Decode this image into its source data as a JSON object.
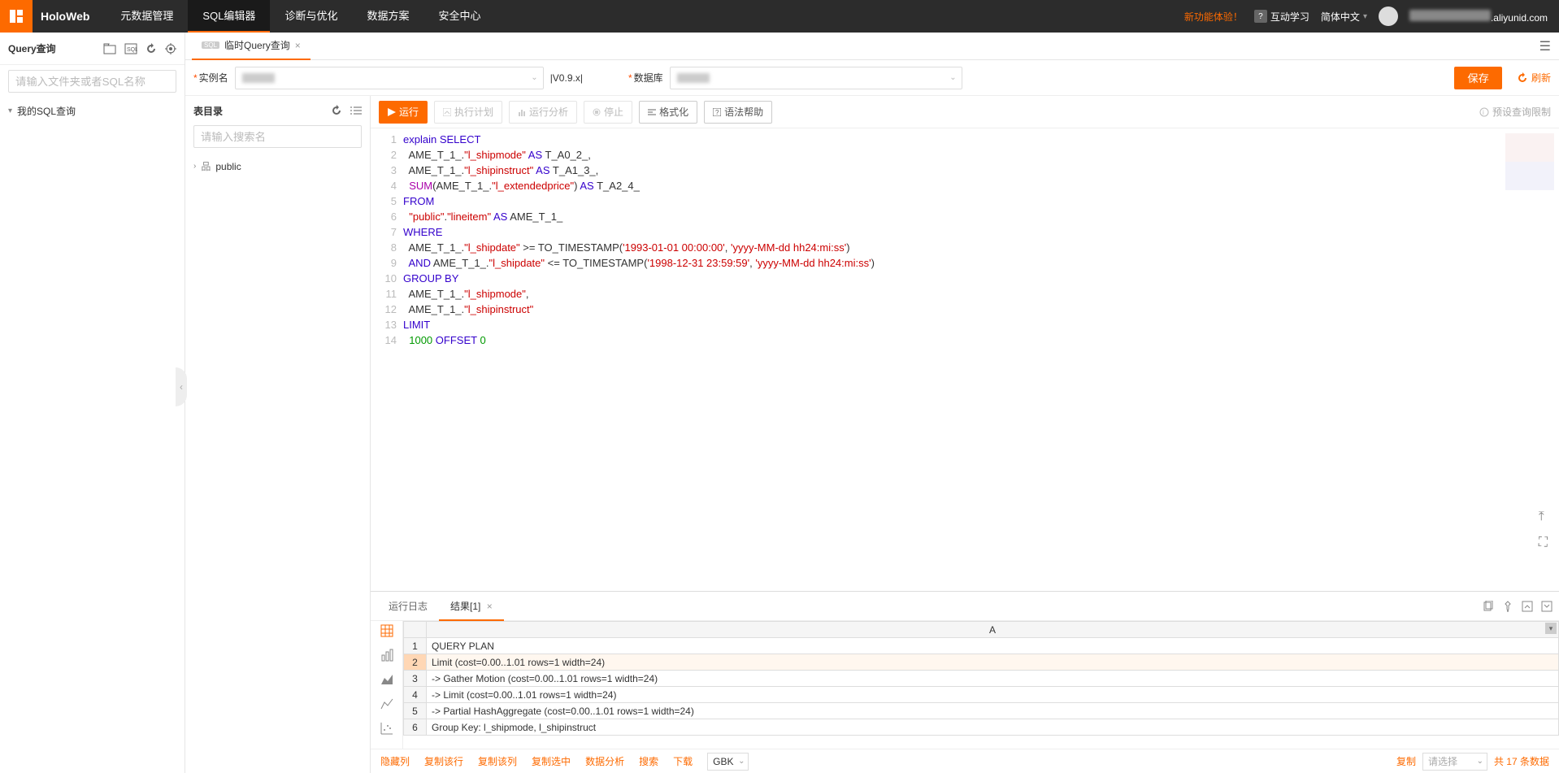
{
  "brand": "HoloWeb",
  "nav": [
    "元数据管理",
    "SQL编辑器",
    "诊断与优化",
    "数据方案",
    "安全中心"
  ],
  "nav_active": 1,
  "top_right": {
    "new_exp": "新功能体验！",
    "interactive": "互动学习",
    "lang": "简体中文",
    "user_suffix": ".aliyunid.com"
  },
  "sidebar": {
    "title": "Query查询",
    "search_ph": "请输入文件夹或者SQL名称",
    "tree_root": "我的SQL查询"
  },
  "tab": {
    "label": "临时Query查询"
  },
  "params": {
    "instance_lbl": "实例名",
    "version": "|V0.9.x|",
    "db_lbl": "数据库",
    "save": "保存",
    "refresh": "刷新"
  },
  "table_panel": {
    "title": "表目录",
    "search_ph": "请输入搜索名",
    "node": "public"
  },
  "toolbar": {
    "run": "运行",
    "plan": "执行计划",
    "analyze": "运行分析",
    "stop": "停止",
    "format": "格式化",
    "grammar": "语法帮助",
    "hint": "预设查询限制"
  },
  "code_lines": [
    [
      [
        "kw",
        "explain"
      ],
      [
        "",
        ""
      ],
      [
        "",
        " "
      ],
      [
        "kw",
        "SELECT"
      ]
    ],
    [
      [
        "",
        "  AME_T_1_."
      ],
      [
        "col",
        "\"l_shipmode\""
      ],
      [
        "",
        " "
      ],
      [
        "kw",
        "AS"
      ],
      [
        "",
        " T_A0_2_,"
      ]
    ],
    [
      [
        "",
        "  AME_T_1_."
      ],
      [
        "col",
        "\"l_shipinstruct\""
      ],
      [
        "",
        " "
      ],
      [
        "kw",
        "AS"
      ],
      [
        "",
        " T_A1_3_,"
      ]
    ],
    [
      [
        "",
        "  "
      ],
      [
        "fn",
        "SUM"
      ],
      [
        "",
        "(AME_T_1_."
      ],
      [
        "col",
        "\"l_extendedprice\""
      ],
      [
        "",
        ") "
      ],
      [
        "kw",
        "AS"
      ],
      [
        "",
        " T_A2_4_"
      ]
    ],
    [
      [
        "kw",
        "FROM"
      ]
    ],
    [
      [
        "",
        "  "
      ],
      [
        "col",
        "\"public\""
      ],
      [
        "",
        "."
      ],
      [
        "col",
        "\"lineitem\""
      ],
      [
        "",
        " "
      ],
      [
        "kw",
        "AS"
      ],
      [
        "",
        " AME_T_1_"
      ]
    ],
    [
      [
        "kw",
        "WHERE"
      ]
    ],
    [
      [
        "",
        "  AME_T_1_."
      ],
      [
        "col",
        "\"l_shipdate\""
      ],
      [
        "",
        " >= TO_TIMESTAMP("
      ],
      [
        "str",
        "'1993-01-01 00:00:00'"
      ],
      [
        "",
        ", "
      ],
      [
        "str",
        "'yyyy-MM-dd hh24:mi:ss'"
      ],
      [
        "",
        ")"
      ]
    ],
    [
      [
        "",
        "  "
      ],
      [
        "kw",
        "AND"
      ],
      [
        "",
        " AME_T_1_."
      ],
      [
        "col",
        "\"l_shipdate\""
      ],
      [
        "",
        " <= TO_TIMESTAMP("
      ],
      [
        "str",
        "'1998-12-31 23:59:59'"
      ],
      [
        "",
        ", "
      ],
      [
        "str",
        "'yyyy-MM-dd hh24:mi:ss'"
      ],
      [
        "",
        ")"
      ]
    ],
    [
      [
        "kw",
        "GROUP BY"
      ]
    ],
    [
      [
        "",
        "  AME_T_1_."
      ],
      [
        "col",
        "\"l_shipmode\""
      ],
      [
        "",
        ","
      ]
    ],
    [
      [
        "",
        "  AME_T_1_."
      ],
      [
        "col",
        "\"l_shipinstruct\""
      ]
    ],
    [
      [
        "kw",
        "LIMIT"
      ]
    ],
    [
      [
        "",
        "  "
      ],
      [
        "num",
        "1000"
      ],
      [
        "",
        " "
      ],
      [
        "kw",
        "OFFSET"
      ],
      [
        "",
        " "
      ],
      [
        "num",
        "0"
      ]
    ]
  ],
  "results": {
    "tab_log": "运行日志",
    "tab_res": "结果[1]",
    "col_header": "A",
    "rows": [
      "QUERY PLAN",
      "Limit  (cost=0.00..1.01 rows=1 width=24)",
      "    ->  Gather Motion  (cost=0.00..1.01 rows=1 width=24)",
      "          ->  Limit  (cost=0.00..1.01 rows=1 width=24)",
      "                ->  Partial HashAggregate  (cost=0.00..1.01 rows=1 width=24)",
      "                      Group Key: l_shipmode, l_shipinstruct"
    ],
    "selected_row": 1
  },
  "footer": {
    "hide": "隐藏列",
    "copy_row": "复制该行",
    "copy_col": "复制该列",
    "copy_sel": "复制选中",
    "analyze": "数据分析",
    "search": "搜索",
    "download": "下载",
    "encoding": "GBK",
    "copy": "复制",
    "select_ph": "请选择",
    "total": "共 17 条数据"
  }
}
